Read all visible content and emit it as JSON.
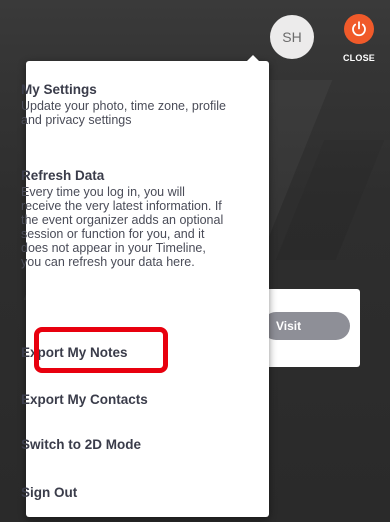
{
  "header": {
    "avatar_initials": "SH",
    "close_label": "CLOSE"
  },
  "background": {
    "visit_button_label": "Visit"
  },
  "menu": {
    "items": [
      {
        "label": "My Settings",
        "description": "Update your photo, time zone, profile and privacy settings"
      },
      {
        "label": "Refresh Data",
        "description": "Every time you log in, you will receive the very latest information. If the event organizer adds an optional session or function for you, and it does not appear in your Timeline, you can refresh your data here."
      },
      {
        "label": "Export My Notes"
      },
      {
        "label": "Export My Contacts"
      },
      {
        "label": "Switch to 2D Mode"
      },
      {
        "label": "Sign Out"
      }
    ]
  },
  "colors": {
    "accent_power": "#f05a2a",
    "highlight": "#e8000e",
    "menu_text": "#3a3c4a"
  }
}
